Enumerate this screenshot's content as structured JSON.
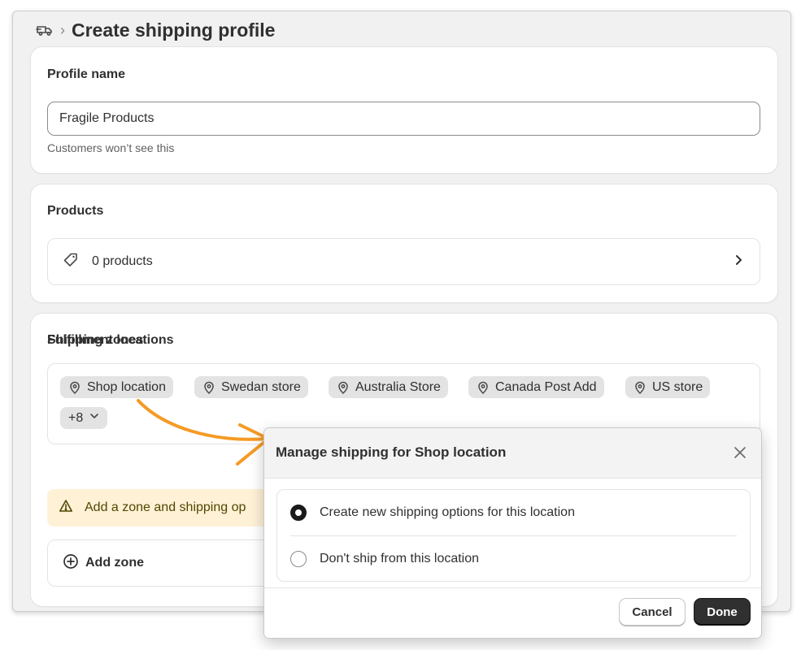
{
  "header": {
    "breadcrumb_icon": "truck-icon",
    "separator": "›",
    "title": "Create shipping profile"
  },
  "profile_card": {
    "title": "Profile name",
    "input_value": "Fragile Products",
    "help_text": "Customers won’t see this"
  },
  "products_card": {
    "title": "Products",
    "row_label": "0 products",
    "row_icon": "tag-icon",
    "chevron_icon": "chevron-right-icon"
  },
  "fulfillment_card": {
    "title": "Fulfillment locations",
    "locations": [
      "Shop location",
      "Swedan store",
      "Australia Store",
      "Canada Post Add",
      "US store"
    ],
    "more_chip": "+8",
    "zones_title": "Shipping zones",
    "banner_text": "Add a zone and shipping op",
    "add_zone_label": "Add zone"
  },
  "modal": {
    "title": "Manage shipping for Shop location",
    "options": [
      {
        "label": "Create new shipping options for this location",
        "selected": true
      },
      {
        "label": "Don't ship from this location",
        "selected": false
      }
    ],
    "cancel_label": "Cancel",
    "done_label": "Done"
  },
  "colors": {
    "accent_arrow": "#f59a23",
    "banner_bg": "#fff1d6",
    "primary_button": "#303030",
    "chip_bg": "#e3e3e3"
  }
}
